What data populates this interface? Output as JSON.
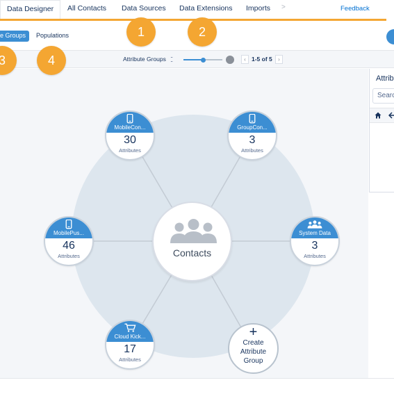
{
  "top_nav": {
    "tabs": [
      {
        "label": "Data Designer",
        "active": true
      },
      {
        "label": "All Contacts"
      },
      {
        "label": "Data Sources"
      },
      {
        "label": "Data Extensions"
      },
      {
        "label": "Imports"
      }
    ],
    "more_glyph": ">",
    "feedback": "Feedback"
  },
  "sub_nav": {
    "attribute_groups": "e Groups",
    "populations": "Populations"
  },
  "badges": [
    "1",
    "2",
    "3",
    "4"
  ],
  "toolbar": {
    "label": "Attribute Groups",
    "slider_value_fraction": 0.5,
    "prev": "‹",
    "next": "›",
    "pager": "1-5 of 5"
  },
  "right_panel": {
    "title": "Attrib",
    "search_placeholder": "Searc",
    "home_icon": "home-icon",
    "back_icon": "back-arrow-icon"
  },
  "center": {
    "label": "Contacts",
    "icon": "people-icon"
  },
  "nodes": [
    {
      "name": "MobileCon...",
      "count": "30",
      "sub": "Attributes",
      "icon": "mobile-phone-icon"
    },
    {
      "name": "GroupCon...",
      "count": "3",
      "sub": "Attributes",
      "icon": "mobile-phone-icon"
    },
    {
      "name": "MobilePus...",
      "count": "46",
      "sub": "Attributes",
      "icon": "mobile-phone-icon"
    },
    {
      "name": "System Data",
      "count": "3",
      "sub": "Attributes",
      "icon": "people-icon"
    },
    {
      "name": "Cloud Kick...",
      "count": "17",
      "sub": "Attributes",
      "icon": "shopping-cart-icon"
    }
  ],
  "create": {
    "plus": "+",
    "line1": "Create",
    "line2": "Attribute",
    "line3": "Group"
  },
  "colors": {
    "accent": "#f4a632",
    "brand": "#3c8ed3",
    "text": "#16325c"
  }
}
